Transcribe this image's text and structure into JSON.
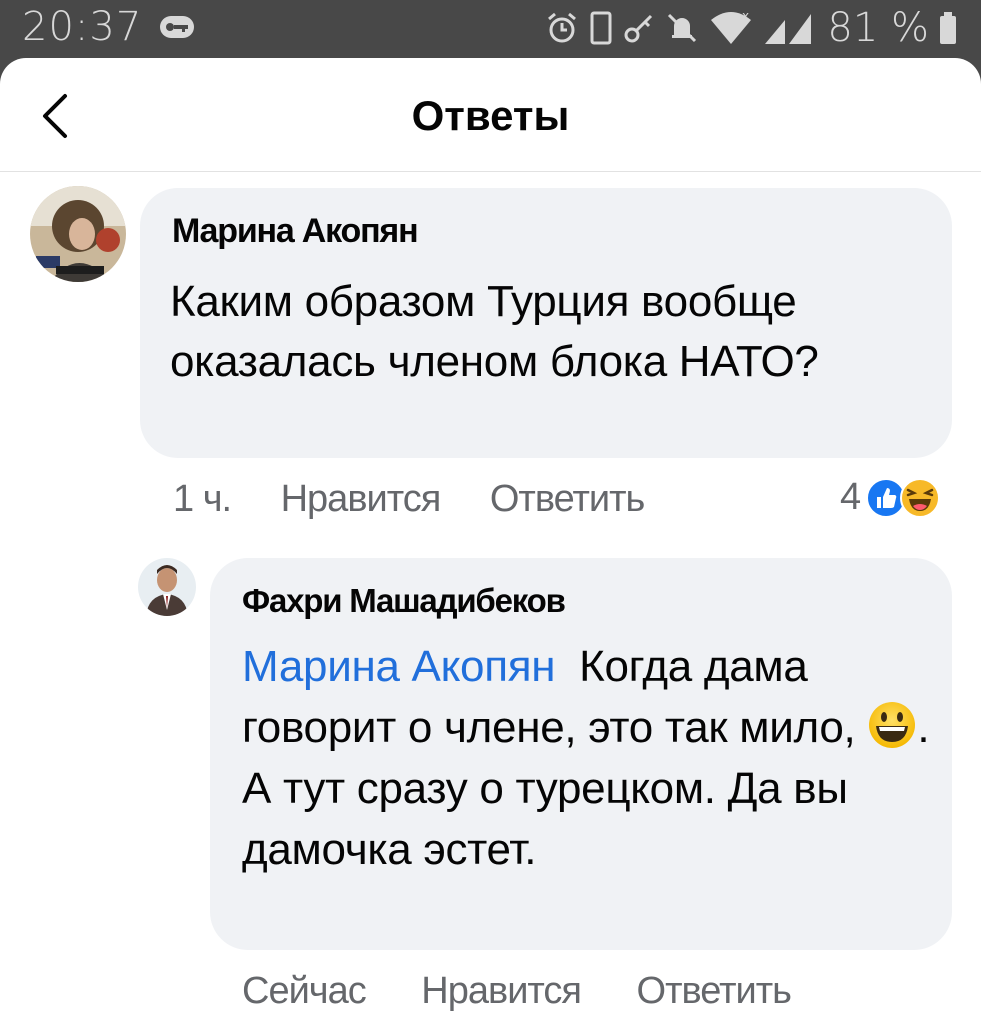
{
  "status_bar": {
    "time": "20:37",
    "battery_text": "81 %",
    "icons": [
      "key-icon",
      "alarm-icon",
      "vibrate-icon",
      "vpn-key-icon",
      "mute-icon",
      "wifi-icon",
      "signal-icon",
      "battery-icon"
    ]
  },
  "header": {
    "back_icon": "chevron-left-icon",
    "title": "Ответы"
  },
  "comments": [
    {
      "author": "Марина Акопян",
      "text": "Каким образом Турция вообще оказалась членом блока НАТО?",
      "time": "1 ч.",
      "like_label": "Нравится",
      "reply_label": "Ответить",
      "reaction_count": "4",
      "reactions": [
        "like-reaction-icon",
        "haha-reaction-icon"
      ]
    },
    {
      "author": "Фахри Машадибеков",
      "mention": "Марина Акопян",
      "text_part1": "Когда дама говорит о члене, это так мило,",
      "emoji": "grinning-emoji-icon",
      "text_part2": ". А тут сразу о турецком. Да вы дамочка эстет.",
      "time": "Сейчас",
      "like_label": "Нравится",
      "reply_label": "Ответить"
    }
  ],
  "colors": {
    "status_bar_bg": "#484848",
    "bubble_bg": "#f0f2f5",
    "mention": "#216fdb",
    "meta_text": "#65676b",
    "like_blue": "#1877f2",
    "haha_yellow": "#f7b928"
  }
}
